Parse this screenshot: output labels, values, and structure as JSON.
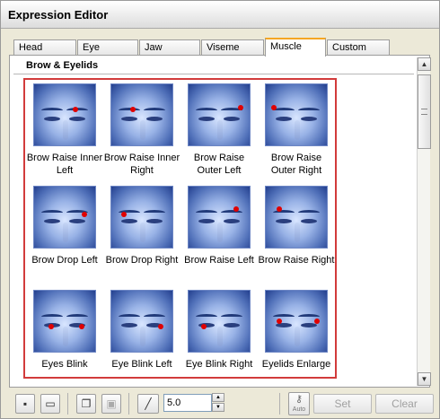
{
  "window": {
    "title": "Expression Editor"
  },
  "tabs": [
    {
      "label": "Head"
    },
    {
      "label": "Eye"
    },
    {
      "label": "Jaw"
    },
    {
      "label": "Viseme"
    },
    {
      "label": "Muscle",
      "active": true
    },
    {
      "label": "Custom"
    }
  ],
  "section": {
    "title": "Brow & Eyelids"
  },
  "expressions": [
    {
      "label": "Brow Raise Inner Left"
    },
    {
      "label": "Brow Raise Inner Right"
    },
    {
      "label": "Brow Raise Outer Left"
    },
    {
      "label": "Brow Raise Outer Right"
    },
    {
      "label": "Brow Drop Left"
    },
    {
      "label": "Brow Drop Right"
    },
    {
      "label": "Brow Raise Left"
    },
    {
      "label": "Brow Raise Right"
    },
    {
      "label": "Eyes Blink"
    },
    {
      "label": "Eye Blink Left"
    },
    {
      "label": "Eye Blink Right"
    },
    {
      "label": "Eyelids Enlarge"
    }
  ],
  "toolbar": {
    "value": "5.0",
    "auto_label": "Auto",
    "set_label": "Set",
    "clear_label": "Clear"
  },
  "colors": {
    "accent_tab": "#f5a623",
    "selection_border": "#d23b3b",
    "marker": "#e00000"
  }
}
